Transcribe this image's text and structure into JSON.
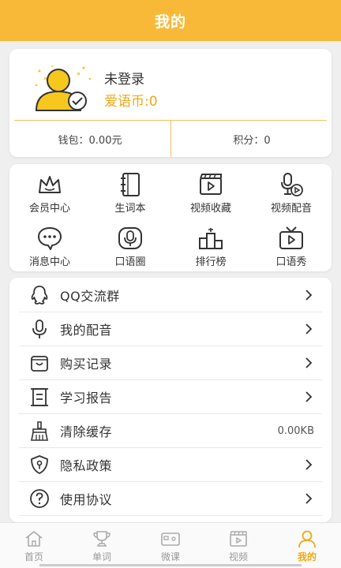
{
  "header": {
    "title": "我的"
  },
  "profile": {
    "username": "未登录",
    "coins": "爱语币:0",
    "wallet": "钱包：0.00元",
    "points": "积分：0"
  },
  "grid": {
    "items": [
      {
        "label": "会员中心",
        "icon": "crown-icon"
      },
      {
        "label": "生词本",
        "icon": "notebook-icon"
      },
      {
        "label": "视频收藏",
        "icon": "video-clapper-icon"
      },
      {
        "label": "视频配音",
        "icon": "microphone-play-icon"
      },
      {
        "label": "消息中心",
        "icon": "chat-bubble-icon"
      },
      {
        "label": "口语圈",
        "icon": "microphone-box-icon"
      },
      {
        "label": "排行榜",
        "icon": "podium-icon"
      },
      {
        "label": "口语秀",
        "icon": "tv-play-icon"
      }
    ]
  },
  "menu": {
    "items": [
      {
        "label": "QQ交流群",
        "icon": "qq-icon"
      },
      {
        "label": "我的配音",
        "icon": "microphone-icon"
      },
      {
        "label": "购买记录",
        "icon": "shopping-bag-icon"
      },
      {
        "label": "学习报告",
        "icon": "report-icon"
      },
      {
        "label": "清除缓存",
        "icon": "broom-icon",
        "value": "0.00KB"
      },
      {
        "label": "隐私政策",
        "icon": "shield-lock-icon"
      },
      {
        "label": "使用协议",
        "icon": "question-icon"
      }
    ]
  },
  "tabbar": {
    "tabs": [
      {
        "label": "首页",
        "icon": "home-icon"
      },
      {
        "label": "单词",
        "icon": "trophy-icon"
      },
      {
        "label": "微课",
        "icon": "camera-icon"
      },
      {
        "label": "视频",
        "icon": "clapper-icon"
      },
      {
        "label": "我的",
        "icon": "user-icon"
      }
    ],
    "active": "我的"
  },
  "colors": {
    "accent": "#f9b938",
    "coin": "#f0a818"
  }
}
